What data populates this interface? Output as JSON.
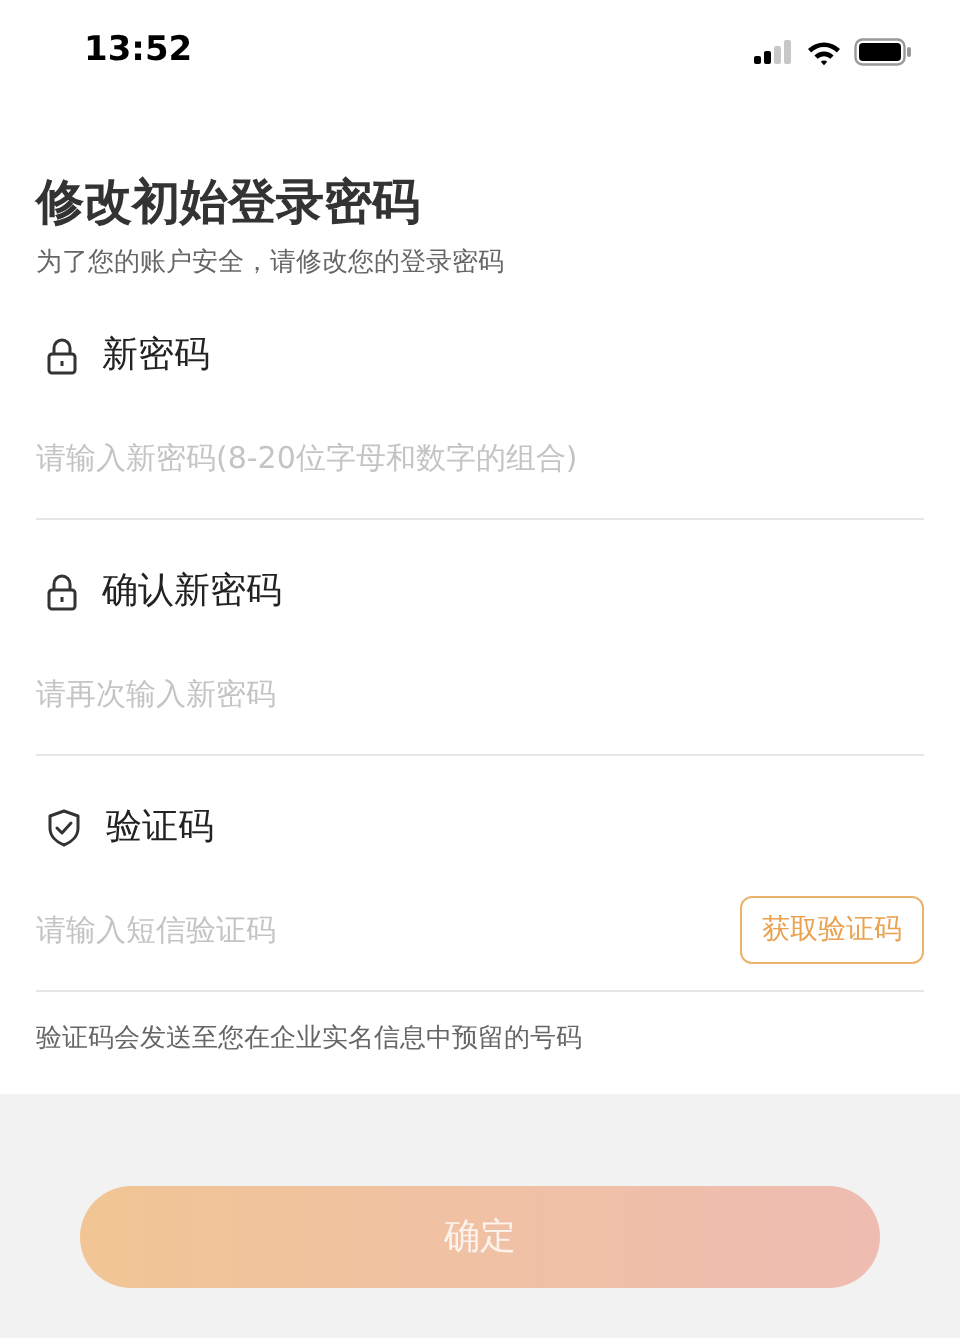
{
  "status_bar": {
    "time": "13:52"
  },
  "title": "修改初始登录密码",
  "subtitle": "为了您的账户安全，请修改您的登录密码",
  "fields": [
    {
      "kind": "lock",
      "label": "新密码",
      "placeholder": "请输入新密码(8-20位字母和数字的组合)"
    },
    {
      "kind": "lock",
      "label": "确认新密码",
      "placeholder": "请再次输入新密码"
    },
    {
      "kind": "shield",
      "label": "验证码",
      "placeholder": "请输入短信验证码",
      "button": "获取验证码"
    }
  ],
  "note": "验证码会发送至您在企业实名信息中预留的号码",
  "confirm_button": {
    "label": "确定",
    "disabled": true
  }
}
